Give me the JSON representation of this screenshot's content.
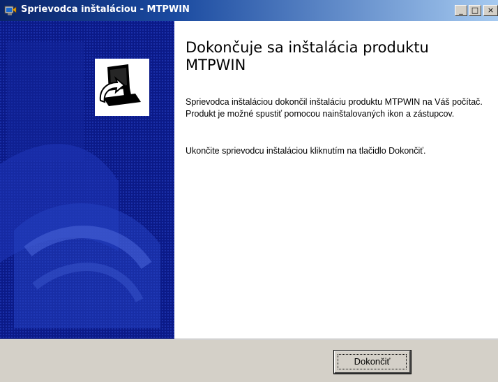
{
  "window": {
    "title": "Sprievodca inštaláciou - MTPWIN",
    "controls": {
      "minimize": "_",
      "maximize": "□",
      "close": "×"
    },
    "title_bar_colors": [
      "#0a246a",
      "#a6caf0"
    ]
  },
  "banner": {
    "background_color": "#0b1a88",
    "logo_icon": "installer-computer-icon"
  },
  "content": {
    "heading": "Dokončuje sa inštalácia produktu MTPWIN",
    "paragraph1": "Sprievodca inštaláciou dokončil inštaláciu produktu MTPWIN na Váš počítač. Produkt je možné spustiť pomocou nainštalovaných ikon a zástupcov.",
    "paragraph2": "Ukončite sprievodcu inštaláciou kliknutím na tlačidlo Dokončiť."
  },
  "footer": {
    "finish_label": "Dokončiť"
  }
}
